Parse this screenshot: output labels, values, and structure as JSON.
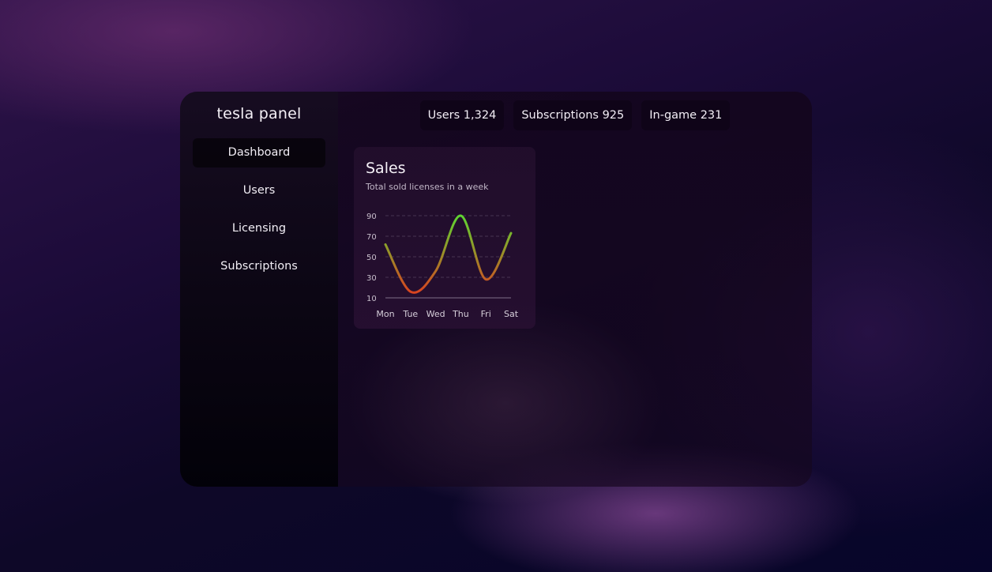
{
  "sidebar": {
    "brand": "tesla panel",
    "items": [
      {
        "label": "Dashboard",
        "active": true
      },
      {
        "label": "Users",
        "active": false
      },
      {
        "label": "Licensing",
        "active": false
      },
      {
        "label": "Subscriptions",
        "active": false
      }
    ]
  },
  "stats": [
    {
      "label": "Users 1,324"
    },
    {
      "label": "Subscriptions 925"
    },
    {
      "label": "In-game 231"
    }
  ],
  "sales_card": {
    "title": "Sales",
    "subtitle": "Total sold licenses in a week"
  },
  "chart_data": {
    "type": "line",
    "title": "Sales",
    "subtitle": "Total sold licenses in a week",
    "categories": [
      "Mon",
      "Tue",
      "Wed",
      "Thu",
      "Fri",
      "Sat"
    ],
    "values": [
      62,
      16,
      36,
      90,
      28,
      73
    ],
    "yticks": [
      10,
      30,
      50,
      70,
      90
    ],
    "ylim": [
      10,
      90
    ],
    "grid": true,
    "gradient_colors": {
      "low": "#e03a1f",
      "high": "#5ed631"
    }
  }
}
